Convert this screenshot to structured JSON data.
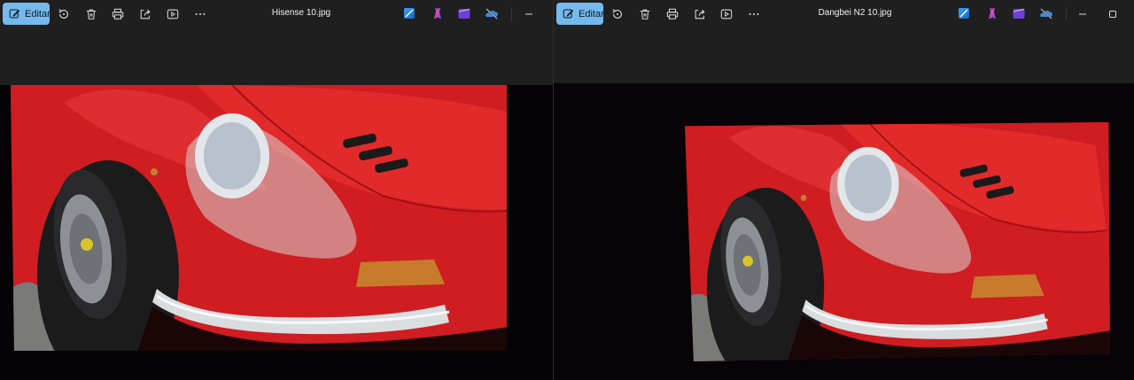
{
  "left_window": {
    "edit_label": "Editar",
    "title": "Hisense 10.jpg",
    "toolbar_icons": [
      "edit-pen-icon",
      "rotate-icon",
      "delete-icon",
      "print-icon",
      "share-icon",
      "slideshow-icon",
      "more-icon"
    ],
    "app_icons": [
      "photo-editor-icon",
      "copilot-icon",
      "clipchamp-icon",
      "onedrive-icon"
    ],
    "window_controls": [
      "minimize-icon"
    ]
  },
  "right_window": {
    "edit_label": "Editar",
    "title": "Dangbei N2 10.jpg",
    "toolbar_icons": [
      "edit-pen-icon",
      "rotate-icon",
      "delete-icon",
      "print-icon",
      "share-icon",
      "slideshow-icon",
      "more-icon"
    ],
    "app_icons": [
      "photo-editor-icon",
      "copilot-icon",
      "clipchamp-icon",
      "onedrive-icon"
    ],
    "window_controls": [
      "minimize-icon",
      "maximize-icon"
    ]
  },
  "colors": {
    "accent": "#76b9ed",
    "chrome": "#1f1f1f",
    "car_red": "#d31c1f"
  }
}
